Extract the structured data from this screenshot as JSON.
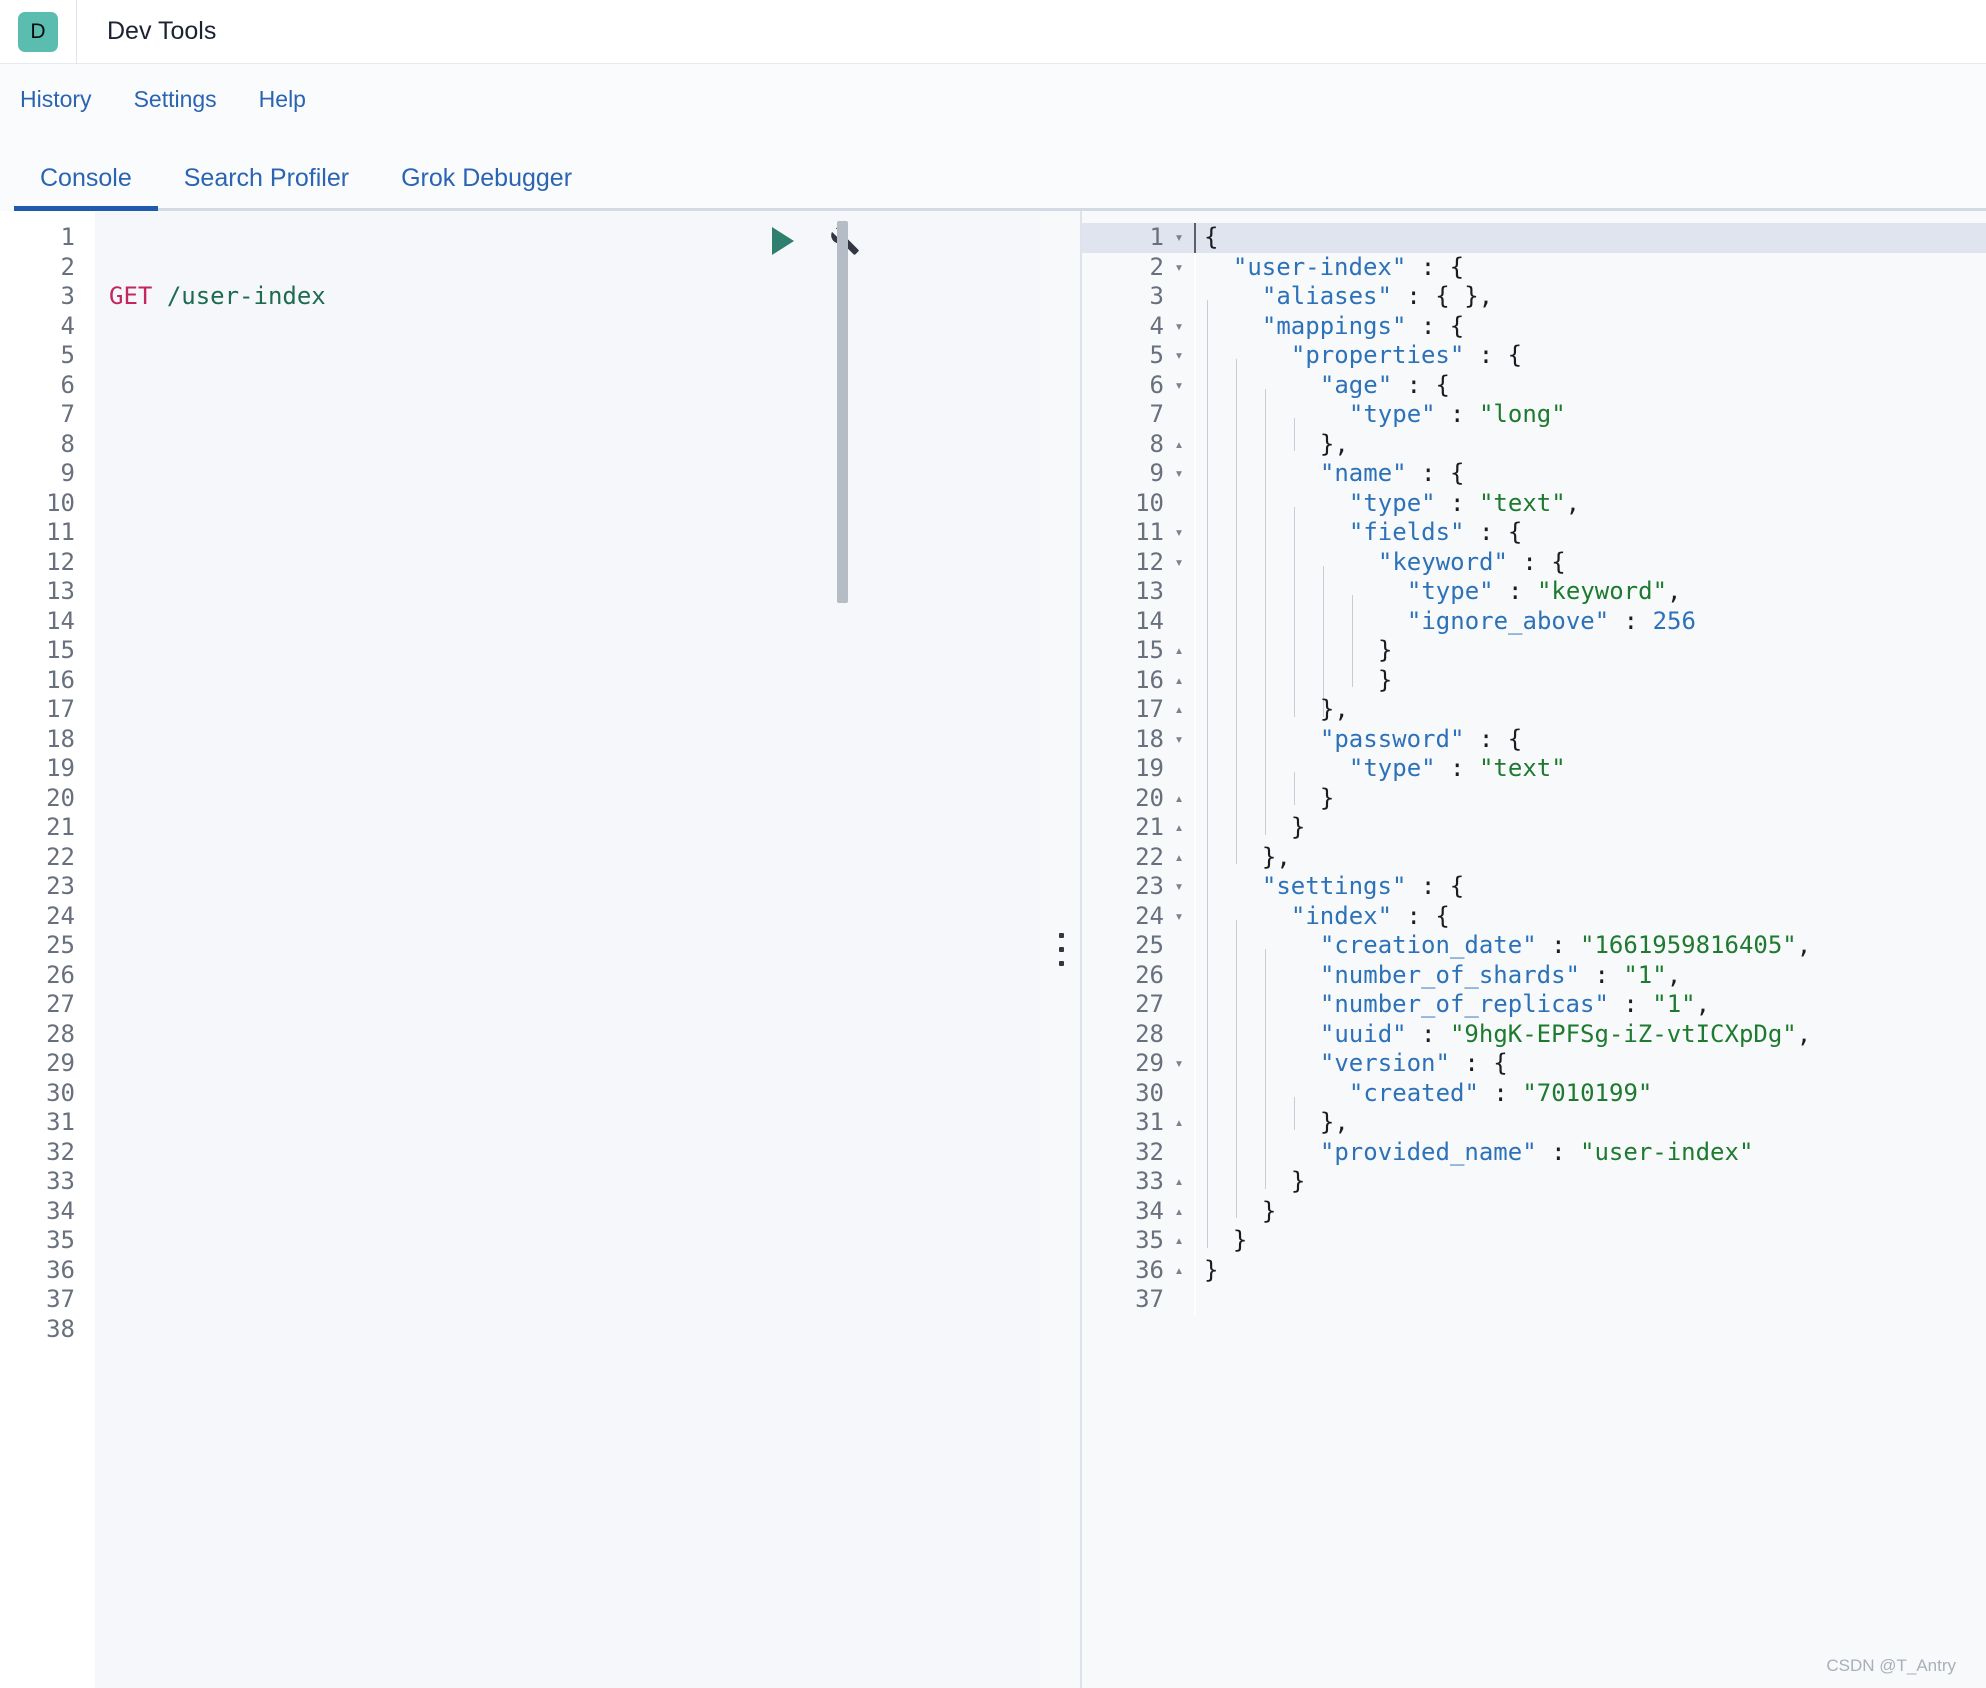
{
  "appbar": {
    "logo_letter": "D",
    "title": "Dev Tools"
  },
  "nav": {
    "items": [
      {
        "label": "History"
      },
      {
        "label": "Settings"
      },
      {
        "label": "Help"
      }
    ]
  },
  "tabs": [
    {
      "label": "Console",
      "active": true
    },
    {
      "label": "Search Profiler",
      "active": false
    },
    {
      "label": "Grok Debugger",
      "active": false
    }
  ],
  "request_editor": {
    "method": "GET",
    "path": "/user-index",
    "total_lines": 38,
    "run_icon": "play-icon",
    "wrench_icon": "wrench-icon"
  },
  "response_editor": {
    "total_lines": 37,
    "active_line": 1,
    "lines": [
      {
        "n": 1,
        "fold": "open",
        "guides": 0,
        "tokens": [
          {
            "t": "{",
            "c": "jp"
          }
        ]
      },
      {
        "n": 2,
        "fold": "open",
        "guides": 0,
        "tokens": [
          {
            "t": "  ",
            "c": "jp"
          },
          {
            "t": "\"user-index\"",
            "c": "jk"
          },
          {
            "t": " : {",
            "c": "jp"
          }
        ]
      },
      {
        "n": 3,
        "fold": "none",
        "guides": 1,
        "tokens": [
          {
            "t": "  ",
            "c": "jp"
          },
          {
            "t": "\"aliases\"",
            "c": "jk"
          },
          {
            "t": " : { },",
            "c": "jp"
          }
        ]
      },
      {
        "n": 4,
        "fold": "open",
        "guides": 1,
        "tokens": [
          {
            "t": "  ",
            "c": "jp"
          },
          {
            "t": "\"mappings\"",
            "c": "jk"
          },
          {
            "t": " : {",
            "c": "jp"
          }
        ]
      },
      {
        "n": 5,
        "fold": "open",
        "guides": 2,
        "tokens": [
          {
            "t": "  ",
            "c": "jp"
          },
          {
            "t": "\"properties\"",
            "c": "jk"
          },
          {
            "t": " : {",
            "c": "jp"
          }
        ]
      },
      {
        "n": 6,
        "fold": "open",
        "guides": 3,
        "tokens": [
          {
            "t": "  ",
            "c": "jp"
          },
          {
            "t": "\"age\"",
            "c": "jk"
          },
          {
            "t": " : {",
            "c": "jp"
          }
        ]
      },
      {
        "n": 7,
        "fold": "none",
        "guides": 4,
        "tokens": [
          {
            "t": "  ",
            "c": "jp"
          },
          {
            "t": "\"type\"",
            "c": "jk"
          },
          {
            "t": " : ",
            "c": "jp"
          },
          {
            "t": "\"long\"",
            "c": "jv"
          }
        ]
      },
      {
        "n": 8,
        "fold": "close",
        "guides": 3,
        "tokens": [
          {
            "t": "  },",
            "c": "jp"
          }
        ]
      },
      {
        "n": 9,
        "fold": "open",
        "guides": 3,
        "tokens": [
          {
            "t": "  ",
            "c": "jp"
          },
          {
            "t": "\"name\"",
            "c": "jk"
          },
          {
            "t": " : {",
            "c": "jp"
          }
        ]
      },
      {
        "n": 10,
        "fold": "none",
        "guides": 4,
        "tokens": [
          {
            "t": "  ",
            "c": "jp"
          },
          {
            "t": "\"type\"",
            "c": "jk"
          },
          {
            "t": " : ",
            "c": "jp"
          },
          {
            "t": "\"text\"",
            "c": "jv"
          },
          {
            "t": ",",
            "c": "jp"
          }
        ]
      },
      {
        "n": 11,
        "fold": "open",
        "guides": 4,
        "tokens": [
          {
            "t": "  ",
            "c": "jp"
          },
          {
            "t": "\"fields\"",
            "c": "jk"
          },
          {
            "t": " : {",
            "c": "jp"
          }
        ]
      },
      {
        "n": 12,
        "fold": "open",
        "guides": 5,
        "tokens": [
          {
            "t": "  ",
            "c": "jp"
          },
          {
            "t": "\"keyword\"",
            "c": "jk"
          },
          {
            "t": " : {",
            "c": "jp"
          }
        ]
      },
      {
        "n": 13,
        "fold": "none",
        "guides": 6,
        "tokens": [
          {
            "t": "  ",
            "c": "jp"
          },
          {
            "t": "\"type\"",
            "c": "jk"
          },
          {
            "t": " : ",
            "c": "jp"
          },
          {
            "t": "\"keyword\"",
            "c": "jv"
          },
          {
            "t": ",",
            "c": "jp"
          }
        ]
      },
      {
        "n": 14,
        "fold": "none",
        "guides": 6,
        "tokens": [
          {
            "t": "  ",
            "c": "jp"
          },
          {
            "t": "\"ignore_above\"",
            "c": "jk"
          },
          {
            "t": " : ",
            "c": "jp"
          },
          {
            "t": "256",
            "c": "jk"
          }
        ]
      },
      {
        "n": 15,
        "fold": "close",
        "guides": 6,
        "tokens": [
          {
            "t": "}",
            "c": "jp"
          }
        ]
      },
      {
        "n": 16,
        "fold": "close",
        "guides": 5,
        "tokens": [
          {
            "t": "  }",
            "c": "jp"
          }
        ]
      },
      {
        "n": 17,
        "fold": "close",
        "guides": 3,
        "tokens": [
          {
            "t": "  },",
            "c": "jp"
          }
        ]
      },
      {
        "n": 18,
        "fold": "open",
        "guides": 3,
        "tokens": [
          {
            "t": "  ",
            "c": "jp"
          },
          {
            "t": "\"password\"",
            "c": "jk"
          },
          {
            "t": " : {",
            "c": "jp"
          }
        ]
      },
      {
        "n": 19,
        "fold": "none",
        "guides": 4,
        "tokens": [
          {
            "t": "  ",
            "c": "jp"
          },
          {
            "t": "\"type\"",
            "c": "jk"
          },
          {
            "t": " : ",
            "c": "jp"
          },
          {
            "t": "\"text\"",
            "c": "jv"
          }
        ]
      },
      {
        "n": 20,
        "fold": "close",
        "guides": 3,
        "tokens": [
          {
            "t": "  }",
            "c": "jp"
          }
        ]
      },
      {
        "n": 21,
        "fold": "close",
        "guides": 2,
        "tokens": [
          {
            "t": "  }",
            "c": "jp"
          }
        ]
      },
      {
        "n": 22,
        "fold": "close",
        "guides": 1,
        "tokens": [
          {
            "t": "  },",
            "c": "jp"
          }
        ]
      },
      {
        "n": 23,
        "fold": "open",
        "guides": 1,
        "tokens": [
          {
            "t": "  ",
            "c": "jp"
          },
          {
            "t": "\"settings\"",
            "c": "jk"
          },
          {
            "t": " : {",
            "c": "jp"
          }
        ]
      },
      {
        "n": 24,
        "fold": "open",
        "guides": 2,
        "tokens": [
          {
            "t": "  ",
            "c": "jp"
          },
          {
            "t": "\"index\"",
            "c": "jk"
          },
          {
            "t": " : {",
            "c": "jp"
          }
        ]
      },
      {
        "n": 25,
        "fold": "none",
        "guides": 3,
        "tokens": [
          {
            "t": "  ",
            "c": "jp"
          },
          {
            "t": "\"creation_date\"",
            "c": "jk"
          },
          {
            "t": " : ",
            "c": "jp"
          },
          {
            "t": "\"1661959816405\"",
            "c": "jv"
          },
          {
            "t": ",",
            "c": "jp"
          }
        ]
      },
      {
        "n": 26,
        "fold": "none",
        "guides": 3,
        "tokens": [
          {
            "t": "  ",
            "c": "jp"
          },
          {
            "t": "\"number_of_shards\"",
            "c": "jk"
          },
          {
            "t": " : ",
            "c": "jp"
          },
          {
            "t": "\"1\"",
            "c": "jv"
          },
          {
            "t": ",",
            "c": "jp"
          }
        ]
      },
      {
        "n": 27,
        "fold": "none",
        "guides": 3,
        "tokens": [
          {
            "t": "  ",
            "c": "jp"
          },
          {
            "t": "\"number_of_replicas\"",
            "c": "jk"
          },
          {
            "t": " : ",
            "c": "jp"
          },
          {
            "t": "\"1\"",
            "c": "jv"
          },
          {
            "t": ",",
            "c": "jp"
          }
        ]
      },
      {
        "n": 28,
        "fold": "none",
        "guides": 3,
        "tokens": [
          {
            "t": "  ",
            "c": "jp"
          },
          {
            "t": "\"uuid\"",
            "c": "jk"
          },
          {
            "t": " : ",
            "c": "jp"
          },
          {
            "t": "\"9hgK-EPFSg-iZ-vtICXpDg\"",
            "c": "jv"
          },
          {
            "t": ",",
            "c": "jp"
          }
        ]
      },
      {
        "n": 29,
        "fold": "open",
        "guides": 3,
        "tokens": [
          {
            "t": "  ",
            "c": "jp"
          },
          {
            "t": "\"version\"",
            "c": "jk"
          },
          {
            "t": " : {",
            "c": "jp"
          }
        ]
      },
      {
        "n": 30,
        "fold": "none",
        "guides": 4,
        "tokens": [
          {
            "t": "  ",
            "c": "jp"
          },
          {
            "t": "\"created\"",
            "c": "jk"
          },
          {
            "t": " : ",
            "c": "jp"
          },
          {
            "t": "\"7010199\"",
            "c": "jv"
          }
        ]
      },
      {
        "n": 31,
        "fold": "close",
        "guides": 3,
        "tokens": [
          {
            "t": "  },",
            "c": "jp"
          }
        ]
      },
      {
        "n": 32,
        "fold": "none",
        "guides": 3,
        "tokens": [
          {
            "t": "  ",
            "c": "jp"
          },
          {
            "t": "\"provided_name\"",
            "c": "jk"
          },
          {
            "t": " : ",
            "c": "jp"
          },
          {
            "t": "\"user-index\"",
            "c": "jv"
          }
        ]
      },
      {
        "n": 33,
        "fold": "close",
        "guides": 2,
        "tokens": [
          {
            "t": "  }",
            "c": "jp"
          }
        ]
      },
      {
        "n": 34,
        "fold": "close",
        "guides": 1,
        "tokens": [
          {
            "t": "  }",
            "c": "jp"
          }
        ]
      },
      {
        "n": 35,
        "fold": "close",
        "guides": 0,
        "tokens": [
          {
            "t": "  }",
            "c": "jp"
          }
        ]
      },
      {
        "n": 36,
        "fold": "close",
        "guides": 0,
        "tokens": [
          {
            "t": "}",
            "c": "jp"
          }
        ]
      },
      {
        "n": 37,
        "fold": "none",
        "guides": 0,
        "tokens": []
      }
    ]
  },
  "watermark": "CSDN @T_Antry",
  "colors": {
    "accent_blue": "#2b64b3",
    "tab_underline": "#1f5bad",
    "logo_bg": "#5bbcb0",
    "method": "#c4265e",
    "url": "#1e6b4f",
    "json_key": "#2d72b8",
    "json_value": "#1e7a2e",
    "play": "#2f7f6e"
  }
}
